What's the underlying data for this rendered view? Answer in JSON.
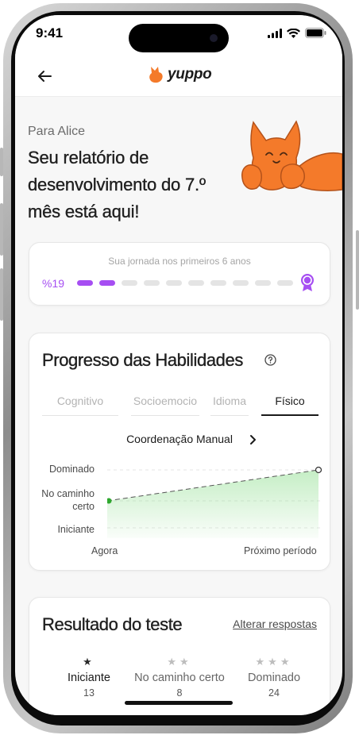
{
  "status": {
    "time": "9:41"
  },
  "header": {
    "logo_text": "yuppo"
  },
  "greeting": {
    "to": "Para Alice",
    "title": "Seu relatório de desenvolvimento do 7.º mês está aqui!"
  },
  "journey": {
    "caption": "Sua jornada nos primeiros 6 anos",
    "percent_label": "%19",
    "segments_total": 10,
    "segments_done": 2,
    "accent": "#a64ef2"
  },
  "progress": {
    "title": "Progresso das Habilidades",
    "tabs": [
      "Cognitivo",
      "Socioemocio",
      "Idioma",
      "Físico"
    ],
    "active_tab": "Físico",
    "skill": "Coordenação Manual",
    "levels": [
      "Dominado",
      "No caminho certo",
      "Iniciante"
    ],
    "x_labels": [
      "Agora",
      "Próximo período"
    ],
    "accent": "#2ea82e"
  },
  "chart_data": {
    "type": "line",
    "categories": [
      "Agora",
      "Próximo período"
    ],
    "y_levels": [
      "Iniciante",
      "No caminho certo",
      "Dominado"
    ],
    "values": [
      "No caminho certo",
      "Dominado"
    ],
    "grid": true
  },
  "result": {
    "title": "Resultado do teste",
    "link": "Alterar respostas",
    "columns": [
      {
        "stars": 1,
        "label": "Iniciante",
        "count": "13",
        "active": true
      },
      {
        "stars": 2,
        "label": "No caminho certo",
        "count": "8",
        "active": false
      },
      {
        "stars": 3,
        "label": "Dominado",
        "count": "24",
        "active": false
      }
    ]
  }
}
